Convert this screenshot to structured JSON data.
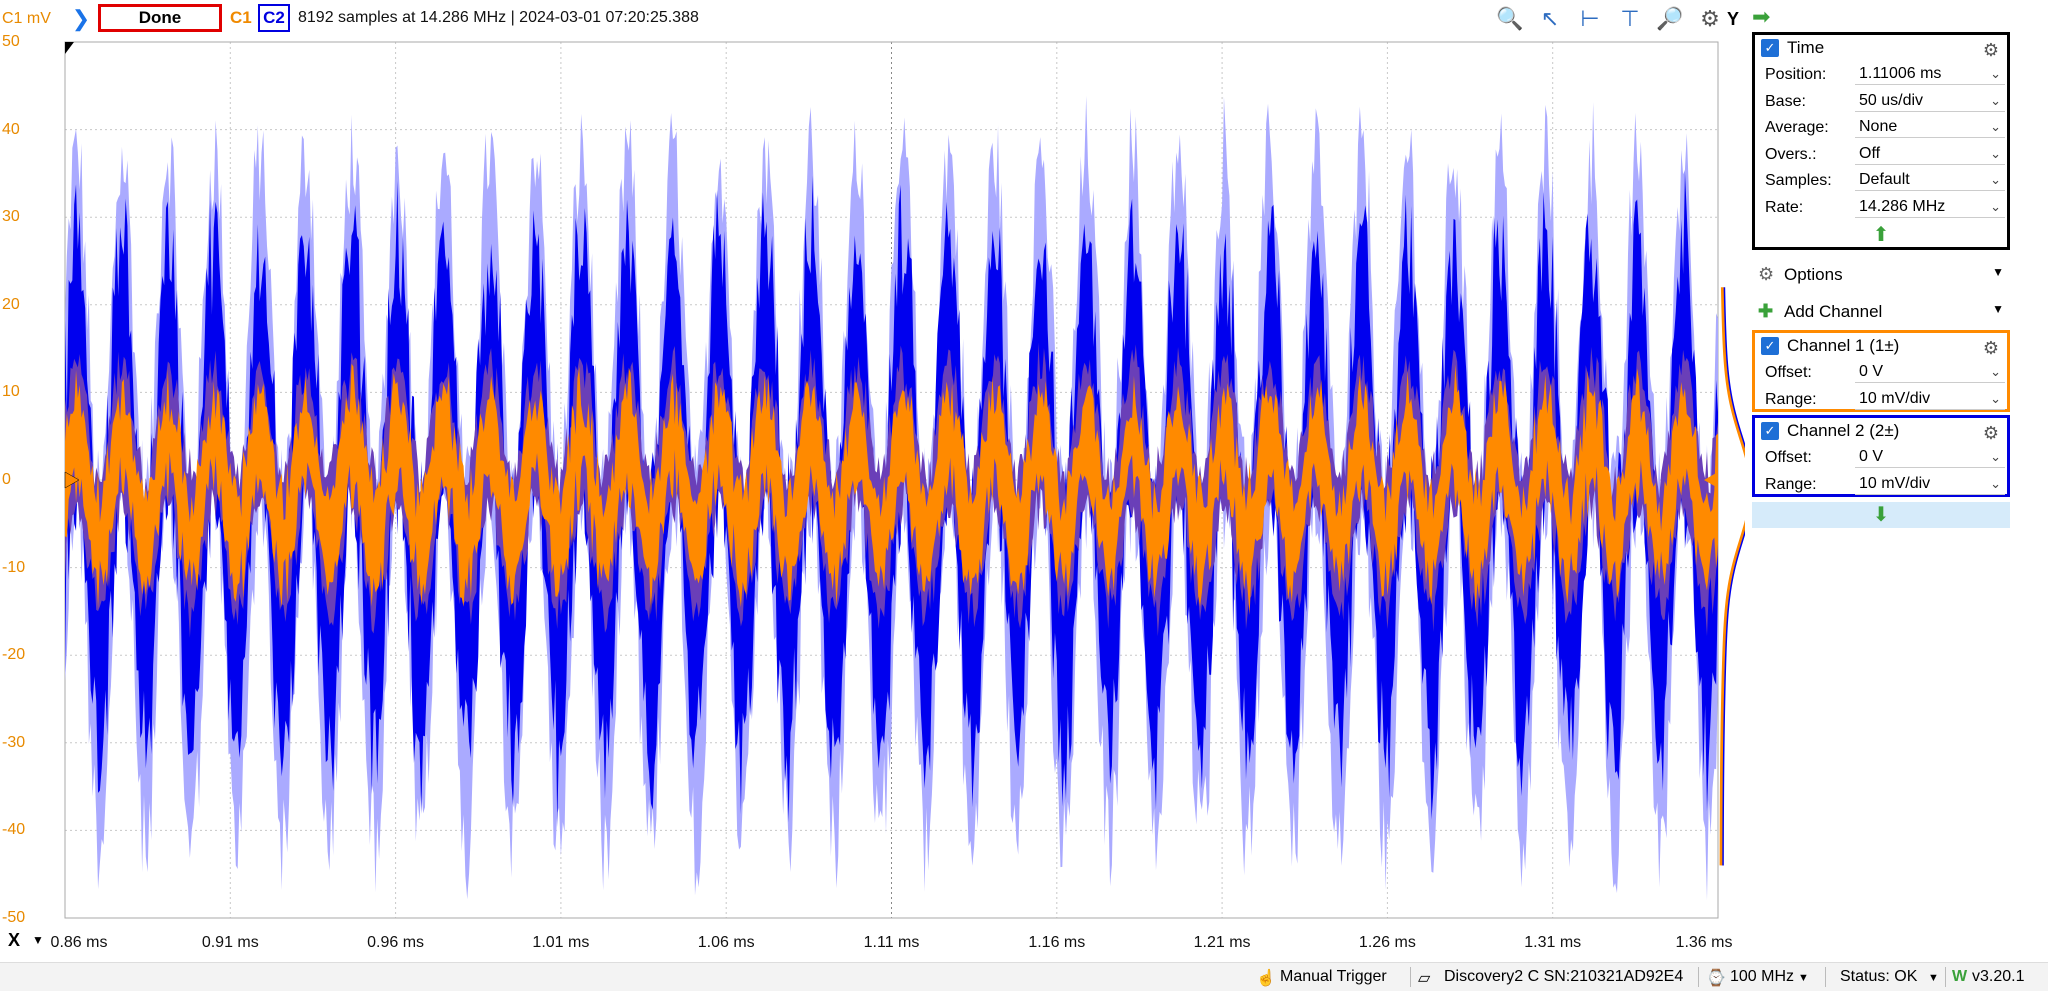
{
  "topbar": {
    "unit_label": "C1 mV",
    "status": "Done",
    "ch1": "C1",
    "ch2": "C2",
    "acq_info": "8192 samples at 14.286 MHz | 2024-03-01 07:20:25.388",
    "y_label": "Y",
    "icons": [
      "zoom-in-icon",
      "cursor-icon",
      "h-cursor-icon",
      "v-cursor-icon",
      "zoom-out-icon",
      "settings-gear-icon"
    ]
  },
  "plot": {
    "x_label_btn": "X",
    "colors": {
      "ch1": "#ff8a00",
      "ch2": "#0000ee",
      "ch2_envelope": "#aaaaff",
      "overlap": "#6a3fb8"
    }
  },
  "chart_data": {
    "type": "line",
    "title": "",
    "ylim": [
      -50,
      50
    ],
    "y_ticks": [
      "50",
      "40",
      "30",
      "20",
      "10",
      "0",
      "-10",
      "-20",
      "-30",
      "-40",
      "-50"
    ],
    "xlim": [
      0.86,
      1.36
    ],
    "x_ticks": [
      "0.86 ms",
      "0.91 ms",
      "0.96 ms",
      "1.01 ms",
      "1.06 ms",
      "1.11 ms",
      "1.16 ms",
      "1.21 ms",
      "1.26 ms",
      "1.31 ms",
      "1.36 ms"
    ],
    "grid": true,
    "cycles": 36,
    "series": [
      {
        "name": "C1",
        "center_mv": -1,
        "amplitude_mv": 6,
        "noise_mv": 5,
        "color": "#ff8a00"
      },
      {
        "name": "C2",
        "center_mv": -2,
        "amplitude_mv": 16,
        "noise_mv": 14,
        "color": "#0000ee"
      }
    ]
  },
  "panel": {
    "time": {
      "title": "Time",
      "rows": [
        {
          "label": "Position:",
          "value": "1.11006 ms"
        },
        {
          "label": "Base:",
          "value": "50 us/div"
        },
        {
          "label": "Average:",
          "value": "None"
        },
        {
          "label": "Overs.:",
          "value": "Off"
        },
        {
          "label": "Samples:",
          "value": "Default"
        },
        {
          "label": "Rate:",
          "value": "14.286 MHz"
        }
      ]
    },
    "options": "Options",
    "add_channel": "Add Channel",
    "channel1": {
      "title": "Channel 1 (1±)",
      "rows": [
        {
          "label": "Offset:",
          "value": "0 V"
        },
        {
          "label": "Range:",
          "value": "10 mV/div"
        }
      ]
    },
    "channel2": {
      "title": "Channel 2 (2±)",
      "rows": [
        {
          "label": "Offset:",
          "value": "0 V"
        },
        {
          "label": "Range:",
          "value": "10 mV/div"
        }
      ]
    }
  },
  "statusbar": {
    "trigger": "Manual Trigger",
    "device": "Discovery2 C SN:210321AD92E4",
    "clock": "100 MHz",
    "status": "Status: OK",
    "version": "v3.20.1"
  }
}
